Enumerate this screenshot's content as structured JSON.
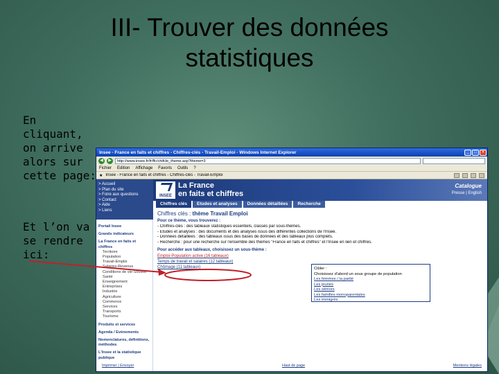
{
  "slide": {
    "title_line1": "III- Trouver des données",
    "title_line2": "statistiques",
    "caption1": "En cliquant, on arrive alors sur cette page:",
    "caption2": "Et l’on va se rendre ici:",
    "accent_color": "#c0202a"
  },
  "browser": {
    "title": "Insee - France en faits et chiffres - Chiffres-clés - Travail-Emploi - Windows Internet Explorer",
    "url": "http://www.insee.fr/fr/ffc/chifcle_theme.asp?theme=3",
    "menu": [
      "Fichier",
      "Edition",
      "Affichage",
      "Favoris",
      "Outils",
      "?"
    ],
    "tab_title": "Insee - France en faits et chiffres - Chiffres-clés - Travail-Emploi"
  },
  "site": {
    "topnav": [
      "> Accueil",
      "> Plan du site",
      "> Foire aux questions",
      "> Contact",
      "> Aide",
      "> Liens"
    ],
    "logo": "INSEE",
    "banner_line1": "La France",
    "banner_line2": "en faits et chiffres",
    "catalogue_title": "Catalogue",
    "catalogue_links": "Presse | English",
    "tabs": [
      "Chiffres clés",
      "Etudes et analyses",
      "Données détaillées",
      "Recherche"
    ],
    "sidebar": {
      "sec1": "Portail Insee",
      "sec2": "Grands indicateurs",
      "sec3": "La France en faits et chiffres",
      "items": [
        "Territoire",
        "Population",
        "Travail-Emploi",
        "Salaires-Revenus",
        "Conditions de vie-Société",
        "Santé",
        "Enseignement",
        "Entreprises",
        "Industrie",
        "Agriculture",
        "Commerce",
        "Services",
        "Transports",
        "Tourisme"
      ],
      "sec4": "Produits et services",
      "sec5": "Agenda / Evènements",
      "sec6": "Nomenclatures, définitions, méthodes",
      "sec7": "L'Insee et la statistique publique"
    },
    "heading_label": "Chiffres clés :",
    "heading_value": "thème Travail Emploi",
    "intro": "Pour ce thème, vous trouverez :",
    "lines": [
      "- Chiffres-clés : des tableaux statistiques essentiels, classés par sous-thèmes.",
      "- Etudes et analyses : des documents et des analyses issus des différentes collections de l'Insee.",
      "- Données détaillées : des tableaux issus des bases de données et des tableaux plus complets.",
      "- Recherche : pour une recherche sur l'ensemble des thèmes \"France en faits et chiffres\" et l'Insee en lien et chiffres."
    ],
    "themes_intro": "Pour accéder aux tableaux, choisissez un sous-thème :",
    "theme_links": [
      "Emploi-Population active (16 tableaux)",
      "Temps de travail et salaires (12 tableaux)",
      "Chômage (11 tableaux)"
    ],
    "choice_intro": "Cibler :",
    "choice_text": "Choisissez d'abord un sous groupe de population",
    "choice_links": [
      "Les femmes / la parité",
      "Les jeunes",
      "Les séniors",
      "Les familles monoparentales",
      "Les immigrés"
    ],
    "footer": [
      "Imprimer | Envoyer",
      "Haut de page",
      "Mentions légales"
    ]
  }
}
